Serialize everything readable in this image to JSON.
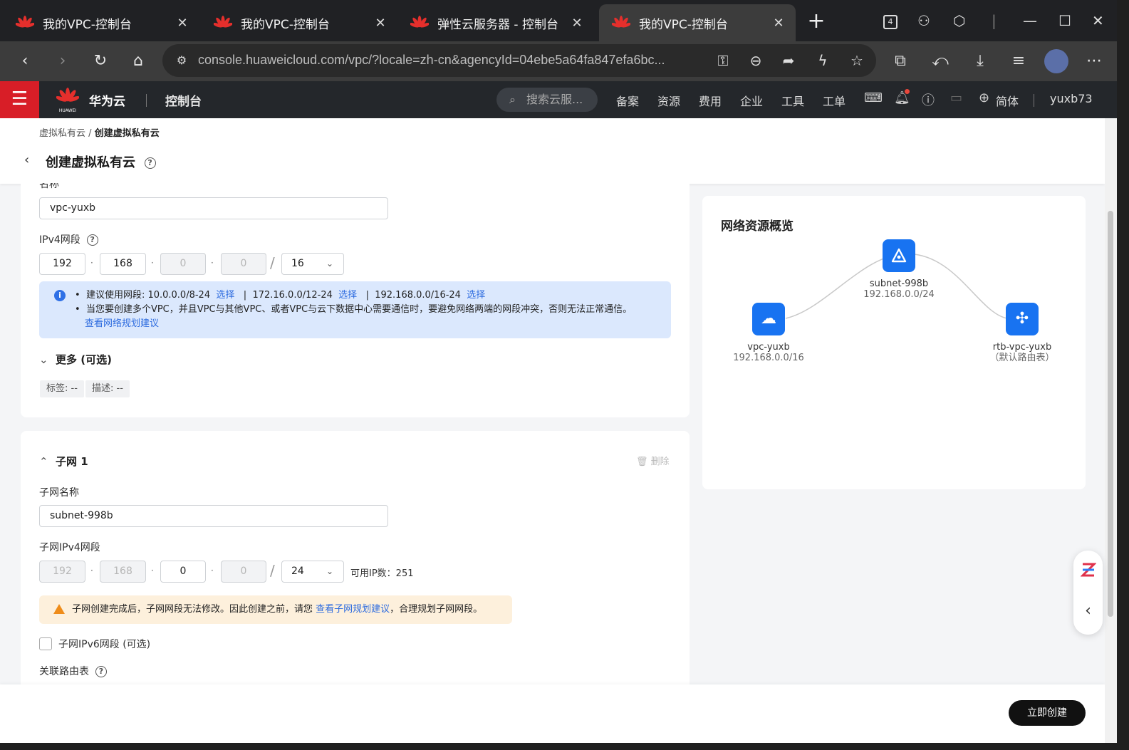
{
  "browser": {
    "tabs": [
      {
        "title": "我的VPC-控制台"
      },
      {
        "title": "我的VPC-控制台"
      },
      {
        "title": "弹性云服务器 - 控制台"
      },
      {
        "title": "我的VPC-控制台"
      }
    ],
    "tab_count_badge": "4",
    "url": "console.huaweicloud.com/vpc/?locale=zh-cn&agencyId=04ebe5a64fa847efa6bc..."
  },
  "topnav": {
    "brand_logo_text": "HUAWEI",
    "brand": "华为云",
    "console": "控制台",
    "search_placeholder": "搜索云服...",
    "items": [
      "备案",
      "资源",
      "费用",
      "企业",
      "工具",
      "工单"
    ],
    "language": "简体",
    "user": "yuxb73"
  },
  "page": {
    "breadcrumb_parent": "虚拟私有云",
    "breadcrumb_sep": "/",
    "breadcrumb_current": "创建虚拟私有云",
    "title": "创建虚拟私有云",
    "help_glyph": "?"
  },
  "vpc": {
    "name_label": "名称",
    "name_value": "vpc-yuxb",
    "ipv4_label": "IPv4网段",
    "ip": [
      "192",
      "168",
      "0",
      "0"
    ],
    "mask": "16",
    "info_line1_prefix": "建议使用网段: 10.0.0.0/8-24",
    "info_select": "选择",
    "info_seg2": "172.16.0.0/12-24",
    "info_seg3": "192.168.0.0/16-24",
    "info_sep": "|",
    "info_line2": "当您要创建多个VPC，并且VPC与其他VPC、或者VPC与云下数据中心需要通信时，要避免网络两端的网段冲突，否则无法正常通信。",
    "info_link": "查看网络规划建议",
    "more_label": "更多 (可选)",
    "tag_label": "标签: --",
    "desc_label": "描述: --"
  },
  "subnet": {
    "section_title": "子网 1",
    "delete_label": "删除",
    "name_label": "子网名称",
    "name_value": "subnet-998b",
    "ipv4_label": "子网IPv4网段",
    "ip": [
      "192",
      "168",
      "0",
      "0"
    ],
    "mask": "24",
    "available_ips": "可用IP数：251",
    "warn_text": "子网创建完成后，子网网段无法修改。因此创建之前，请您",
    "warn_link": "查看子网规划建议",
    "warn_tail": "，合理规划子网网段。",
    "ipv6_label": "子网IPv6网段 (可选)",
    "route_label": "关联路由表"
  },
  "topology": {
    "title": "网络资源概览",
    "vpc_name": "vpc-yuxb",
    "vpc_cidr": "192.168.0.0/16",
    "subnet_name": "subnet-998b",
    "subnet_cidr": "192.168.0.0/24",
    "rtb_name": "rtb-vpc-yuxb",
    "rtb_note": "（默认路由表）"
  },
  "footer": {
    "create_button": "立即创建"
  },
  "colors": {
    "accent_blue": "#1873f1",
    "huawei_red": "#d81e27",
    "info_bg": "#dbe8fd",
    "warn_bg": "#fdf0dc"
  },
  "icons": [
    "huawei-logo-icon",
    "close-icon",
    "plus-icon",
    "search-icon",
    "bell-icon",
    "help-icon",
    "globe-icon",
    "cloud-icon",
    "subnet-icon",
    "route-icon",
    "trash-icon",
    "chevron-down-icon",
    "back-arrow-icon"
  ]
}
